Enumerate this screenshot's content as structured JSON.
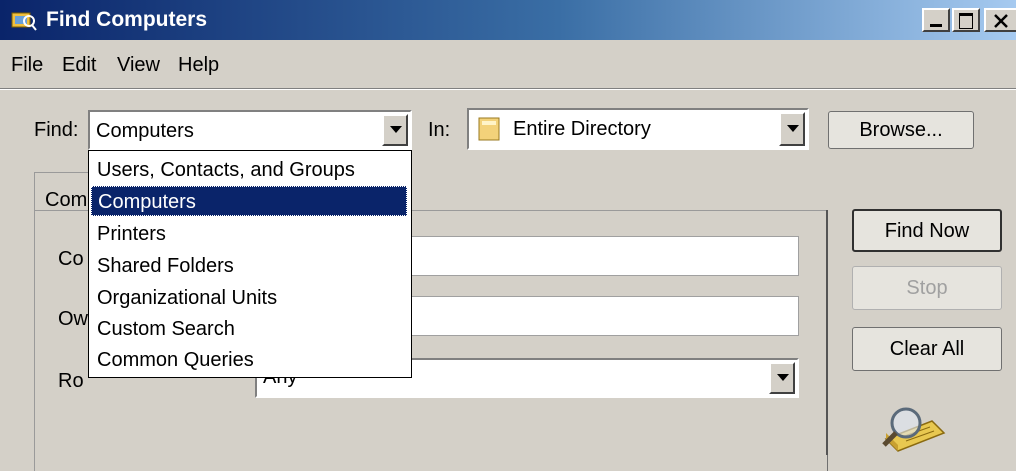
{
  "window": {
    "title": "Find Computers",
    "icon": "find-computers-icon",
    "controls": [
      "minimize",
      "maximize",
      "close"
    ]
  },
  "menu": [
    "File",
    "Edit",
    "View",
    "Help"
  ],
  "find": {
    "label": "Find:",
    "value": "Computers",
    "options": [
      "Users, Contacts, and Groups",
      "Computers",
      "Printers",
      "Shared Folders",
      "Organizational Units",
      "Custom Search",
      "Common Queries"
    ],
    "selected_index": 1
  },
  "in": {
    "label": "In:",
    "value": "Entire Directory",
    "icon": "directory-icon"
  },
  "buttons": {
    "browse": "Browse...",
    "find_now": "Find Now",
    "stop": "Stop",
    "clear_all": "Clear All"
  },
  "tab": {
    "label_partial": "Com"
  },
  "form": {
    "row1_label_partial": "Co",
    "row2_label_partial": "Ow",
    "role_label_partial": "Ro",
    "role_value_partial": "Any"
  },
  "colors": {
    "title_gradient_start": "#0a246a",
    "title_gradient_end": "#a6caf0",
    "selection": "#0a246a",
    "face": "#d4d0c8"
  }
}
